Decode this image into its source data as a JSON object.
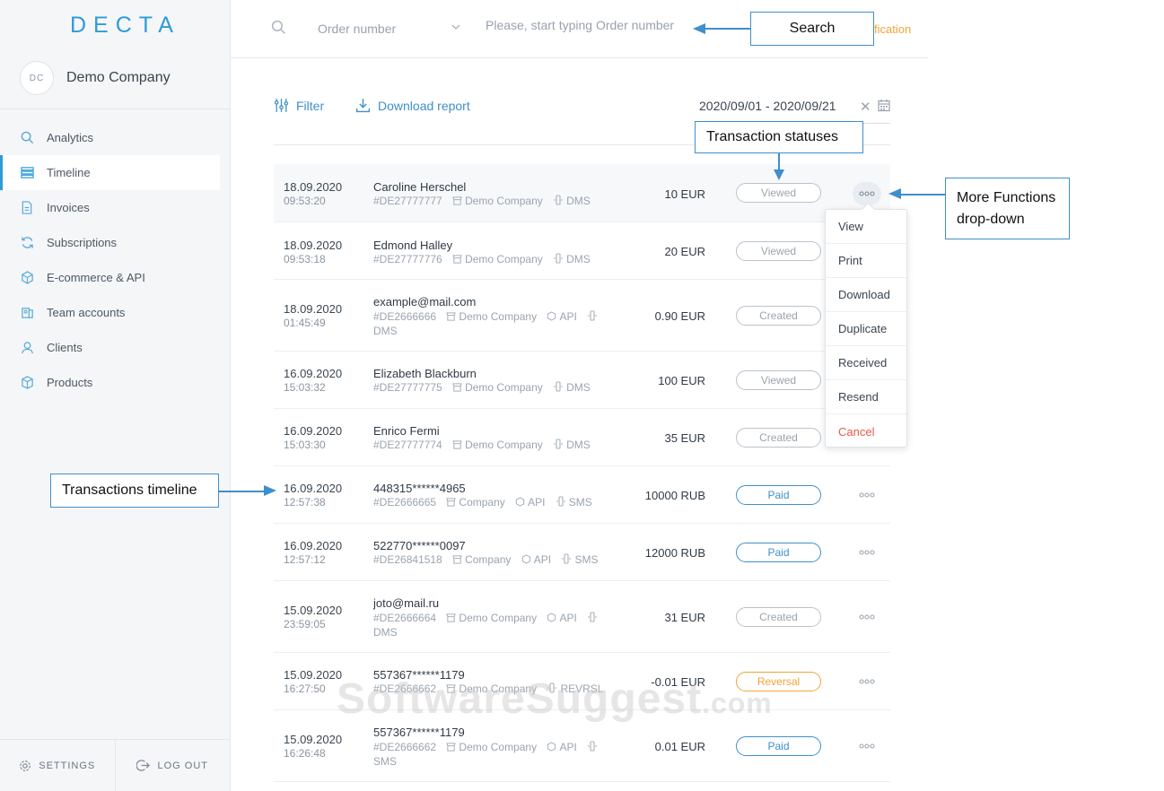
{
  "brand": {
    "logo_text": "DECTA",
    "company_initials": "DC",
    "company_name": "Demo Company"
  },
  "sidebar": {
    "items": [
      {
        "label": "Analytics",
        "icon": "search-icon"
      },
      {
        "label": "Timeline",
        "icon": "list-icon",
        "active": true
      },
      {
        "label": "Invoices",
        "icon": "document-icon"
      },
      {
        "label": "Subscriptions",
        "icon": "refresh-icon"
      },
      {
        "label": "E-commerce & API",
        "icon": "cube-icon"
      },
      {
        "label": "Team accounts",
        "icon": "team-icon"
      },
      {
        "label": "Clients",
        "icon": "user-icon"
      },
      {
        "label": "Products",
        "icon": "box-icon"
      }
    ],
    "settings_label": "SETTINGS",
    "logout_label": "LOG OUT"
  },
  "search": {
    "type_label": "Order number",
    "placeholder": "Please, start typing Order number",
    "notification_text": "fication"
  },
  "toolbar": {
    "filter_label": "Filter",
    "download_label": "Download report",
    "date_range": "2020/09/01 - 2020/09/21",
    "clear_symbol": "✕"
  },
  "transactions": [
    {
      "date": "18.09.2020",
      "time": "09:53:20",
      "name": "Caroline Herschel",
      "id": "#DE27777777",
      "company": "Demo Company",
      "channel": "DMS",
      "amount": "10 EUR",
      "status": "Viewed",
      "kind": "neutral"
    },
    {
      "date": "18.09.2020",
      "time": "09:53:18",
      "name": "Edmond Halley",
      "id": "#DE27777776",
      "company": "Demo Company",
      "channel": "DMS",
      "amount": "20 EUR",
      "status": "Viewed",
      "kind": "neutral"
    },
    {
      "date": "18.09.2020",
      "time": "01:45:49",
      "name": "example@mail.com",
      "id": "#DE2666666",
      "company": "Demo Company",
      "api": "API",
      "channel": "DMS",
      "amount": "0.90 EUR",
      "status": "Created",
      "kind": "neutral"
    },
    {
      "date": "16.09.2020",
      "time": "15:03:32",
      "name": "Elizabeth Blackburn",
      "id": "#DE27777775",
      "company": "Demo Company",
      "channel": "DMS",
      "amount": "100 EUR",
      "status": "Viewed",
      "kind": "neutral"
    },
    {
      "date": "16.09.2020",
      "time": "15:03:30",
      "name": "Enrico Fermi",
      "id": "#DE27777774",
      "company": "Demo Company",
      "channel": "DMS",
      "amount": "35 EUR",
      "status": "Created",
      "kind": "neutral"
    },
    {
      "date": "16.09.2020",
      "time": "12:57:38",
      "name": "448315******4965",
      "id": "#DE2666665",
      "company": "Company",
      "api": "API",
      "channel": "SMS",
      "amount": "10000 RUB",
      "status": "Paid",
      "kind": "paid"
    },
    {
      "date": "16.09.2020",
      "time": "12:57:12",
      "name": "522770******0097",
      "id": "#DE26841518",
      "company": "Company",
      "api": "API",
      "channel": "SMS",
      "amount": "12000 RUB",
      "status": "Paid",
      "kind": "paid"
    },
    {
      "date": "15.09.2020",
      "time": "23:59:05",
      "name": "joto@mail.ru",
      "id": "#DE2666664",
      "company": "Demo Company",
      "api": "API",
      "channel": "DMS",
      "amount": "31 EUR",
      "status": "Created",
      "kind": "neutral"
    },
    {
      "date": "15.09.2020",
      "time": "16:27:50",
      "name": "557367******1179",
      "id": "#DE2666662",
      "company": "Demo Company",
      "channel": "REVRSL",
      "amount": "-0.01 EUR",
      "status": "Reversal",
      "kind": "reversal"
    },
    {
      "date": "15.09.2020",
      "time": "16:26:48",
      "name": "557367******1179",
      "id": "#DE2666662",
      "company": "Demo Company",
      "api": "API",
      "channel": "SMS",
      "amount": "0.01 EUR",
      "status": "Paid",
      "kind": "paid"
    }
  ],
  "more_menu": {
    "items": [
      "View",
      "Print",
      "Download",
      "Duplicate",
      "Received",
      "Resend",
      "Cancel"
    ]
  },
  "callouts": {
    "search": "Search",
    "statuses": "Transaction statuses",
    "more_functions": "More Functions drop-down",
    "timeline": "Transactions timeline"
  },
  "watermark": {
    "main": "SoftwareSuggest",
    "suffix": ".com"
  },
  "colors": {
    "accent": "#2e9bd6",
    "link": "#3f8fcc",
    "warning": "#f0a33a",
    "danger": "#e8574d"
  }
}
